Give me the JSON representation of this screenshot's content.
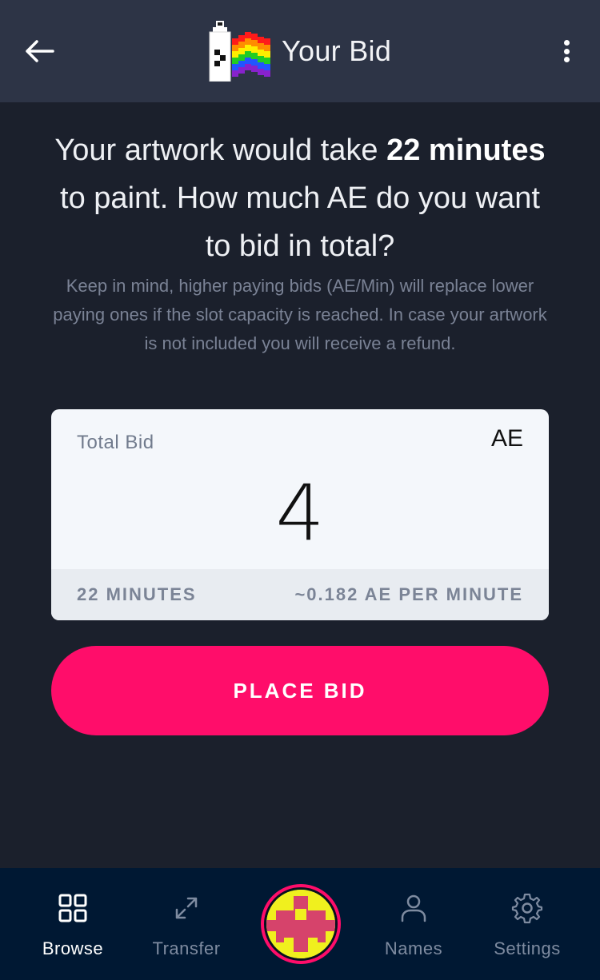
{
  "header": {
    "title": "Your Bid",
    "back_icon": "arrow-left-icon",
    "menu_icon": "more-vertical-icon",
    "logo": "spray-can-rainbow-flag-logo"
  },
  "intro": {
    "headline_part1": "Your artwork would take ",
    "headline_bold1": "22 minutes",
    "headline_part2": " to paint. How much AE do you want to bid in total?",
    "subtext": "Keep in mind, higher paying bids (AE/Min) will replace lower paying ones if the slot capacity is reached. In case your artwork is not included you will receive a refund."
  },
  "bid": {
    "label": "Total Bid",
    "currency": "AE",
    "value": "4",
    "duration": "22 MINUTES",
    "rate": "~0.182 AE PER MINUTE"
  },
  "actions": {
    "place_bid_label": "PLACE BID"
  },
  "bottom_nav": {
    "items": [
      {
        "label": "Browse",
        "icon": "grid-icon",
        "active": true
      },
      {
        "label": "Transfer",
        "icon": "expand-arrows-icon",
        "active": false
      },
      {
        "label": "Names",
        "icon": "user-icon",
        "active": false
      },
      {
        "label": "Settings",
        "icon": "gear-icon",
        "active": false
      }
    ],
    "center_icon": "avatar-identicon"
  },
  "colors": {
    "accent": "#ff0d6a",
    "header_bg": "#2d3446",
    "page_bg": "#1b202c",
    "nav_bg": "#001833",
    "card_bg": "#f4f7fb"
  }
}
